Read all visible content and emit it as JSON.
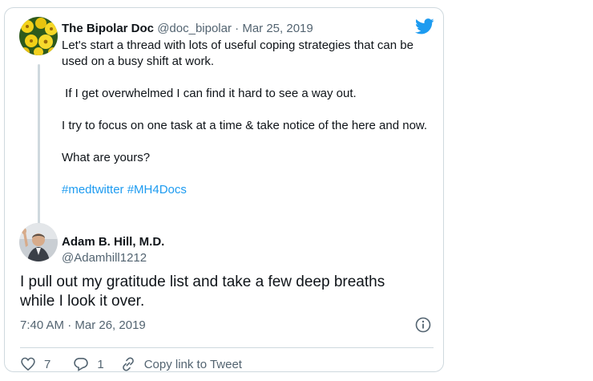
{
  "parent_tweet": {
    "author_name": "The Bipolar Doc",
    "handle": "@doc_bipolar",
    "separator": "·",
    "date": "Mar 25, 2019",
    "paragraphs": [
      "Let's start a thread with lots of useful coping strategies that can be used on a busy shift at work.",
      " If I get overwhelmed I can find it hard to see a way out.",
      "I try to focus on one task at a time & take notice of the here and now.",
      "What are yours?"
    ],
    "hashtags": [
      "#medtwitter",
      "#MH4Docs"
    ]
  },
  "reply_tweet": {
    "author_name": "Adam B. Hill, M.D.",
    "handle": "@Adamhill1212",
    "text": "I pull out my gratitude list and take a few deep breaths while I look it over.",
    "timestamp": "7:40 AM · Mar 26, 2019"
  },
  "actions": {
    "like_count": "7",
    "reply_count": "1",
    "copy_link_label": "Copy link to Tweet"
  },
  "colors": {
    "brand": "#1d9bf0",
    "text": "#0f1419",
    "secondary": "#536471",
    "border": "#cfd9de"
  },
  "icons": [
    "twitter-logo-icon",
    "info-icon",
    "heart-icon",
    "reply-icon",
    "link-icon"
  ]
}
